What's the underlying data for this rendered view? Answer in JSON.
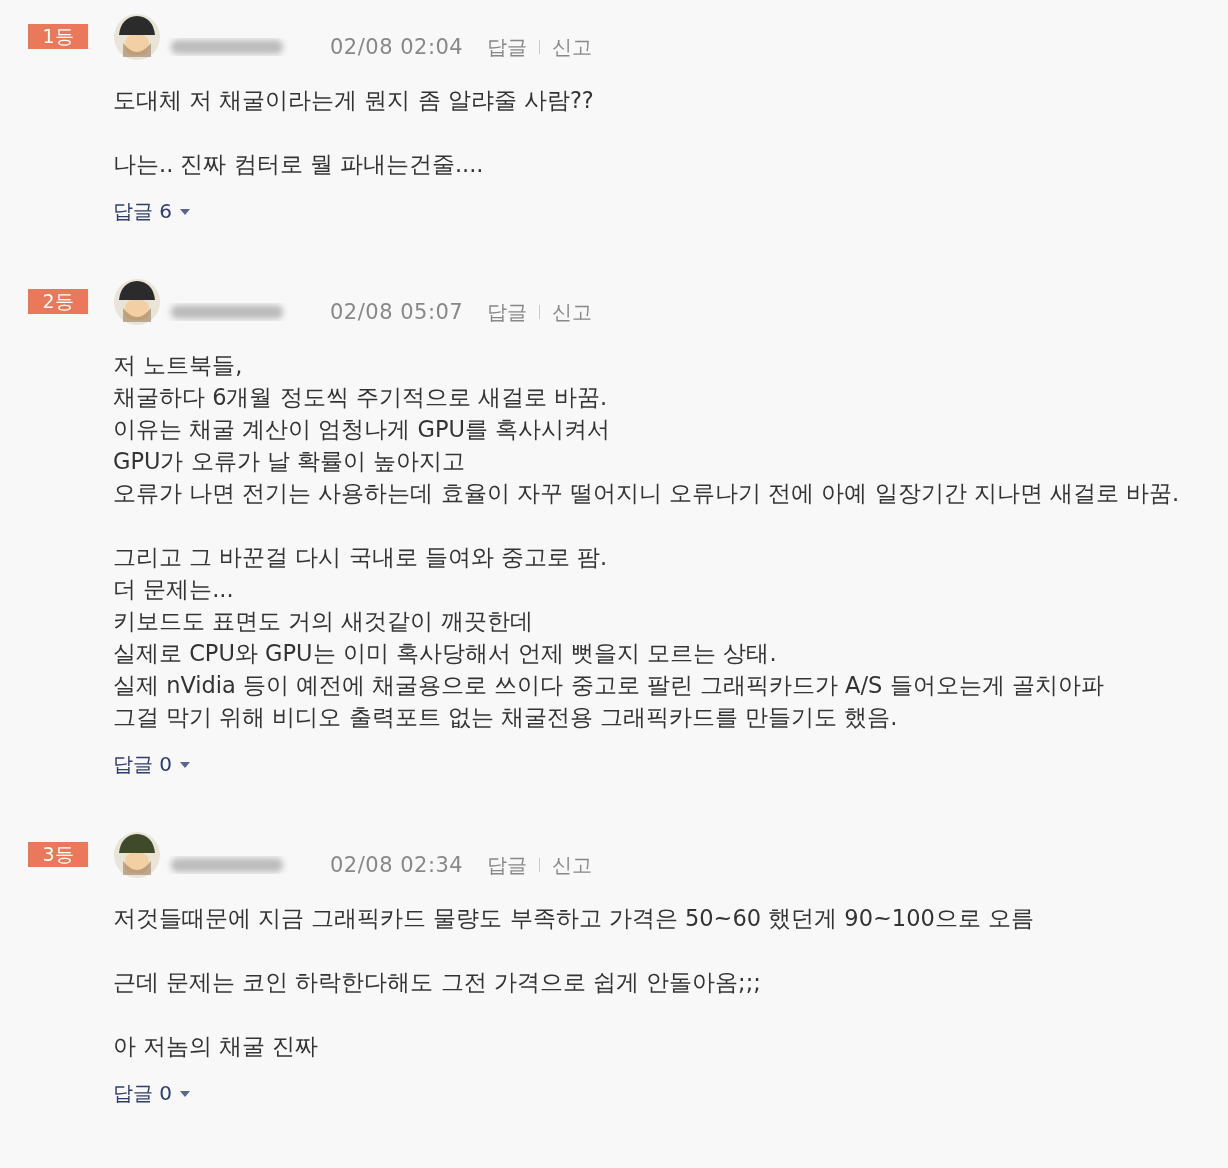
{
  "comments": [
    {
      "rank": "1등",
      "date": "02/08 02:04",
      "actions": [
        "답글",
        "신고"
      ],
      "paragraphs": [
        "도대체 저 채굴이라는게 뭔지 좀 알랴줄 사람??",
        "나는.. 진짜 컴터로 뭘 파내는건줄...."
      ],
      "replies": "답글 6"
    },
    {
      "rank": "2등",
      "date": "02/08 05:07",
      "actions": [
        "답글",
        "신고"
      ],
      "paragraphs": [
        "저 노트북들,\n채굴하다 6개월 정도씩 주기적으로 새걸로 바꿈.\n이유는 채굴 계산이 엄청나게 GPU를 혹사시켜서\nGPU가 오류가 날 확률이 높아지고\n오류가 나면 전기는 사용하는데 효율이 자꾸 떨어지니 오류나기 전에 아예 일장기간 지나면 새걸로 바꿈.",
        "그리고 그 바꾼걸 다시 국내로 들여와 중고로 팜.\n더 문제는...\n키보드도 표면도 거의 새것같이 깨끗한데\n실제로 CPU와 GPU는 이미 혹사당해서 언제 뻣을지 모르는 상태.\n실제 nVidia 등이 예전에 채굴용으로 쓰이다 중고로 팔린 그래픽카드가 A/S 들어오는게 골치아파\n그걸 막기 위해 비디오 출력포트 없는 채굴전용 그래픽카드를 만들기도 했음."
      ],
      "replies": "답글 0"
    },
    {
      "rank": "3등",
      "date": "02/08 02:34",
      "actions": [
        "답글",
        "신고"
      ],
      "paragraphs": [
        "저것들때문에 지금 그래픽카드 물량도 부족하고 가격은 50~60 했던게 90~100으로 오름",
        "근데 문제는 코인 하락한다해도 그전 가격으로 쉽게 안돌아옴;;;",
        "아 저놈의 채굴 진짜"
      ],
      "replies": "답글 0"
    }
  ]
}
